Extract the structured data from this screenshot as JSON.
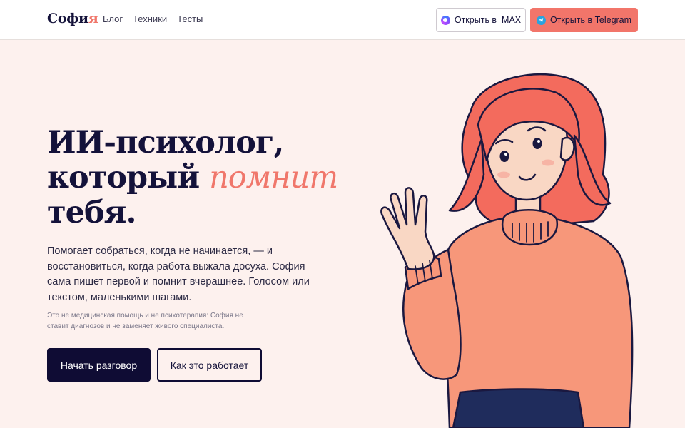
{
  "header": {
    "logo": {
      "main": "Софи",
      "accent": "я"
    },
    "nav": [
      "Блог",
      "Техники",
      "Тесты"
    ],
    "btn_max": {
      "prefix": "Открыть в",
      "brand": "MAX",
      "icon": "max-icon"
    },
    "btn_telegram": {
      "prefix": "Открыть в",
      "brand": "Telegram",
      "icon": "telegram-icon"
    }
  },
  "hero": {
    "title_line1": "ИИ-психолог,",
    "title_line2_plain": "который ",
    "title_line2_accent": "помнит",
    "title_line3": "тебя.",
    "description": "Помогает собраться, когда не начинается, — и восстановиться, когда работа выжала досуха. София сама пишет первой и помнит вчерашнее. Голосом или текстом, маленькими шагами.",
    "note": "Это не медицинская помощь и не психотерапия: София не ставит диагнозов и не заменяет живого специалиста.",
    "primary_button": "Начать разговор",
    "secondary_button": "Как это работает",
    "illustration": "waving-girl-illustration"
  },
  "colors": {
    "accent": "#f0776b",
    "dark": "#0f0c34",
    "hero_bg": "#fdf1ee",
    "telegram_button": "#f2756a"
  }
}
